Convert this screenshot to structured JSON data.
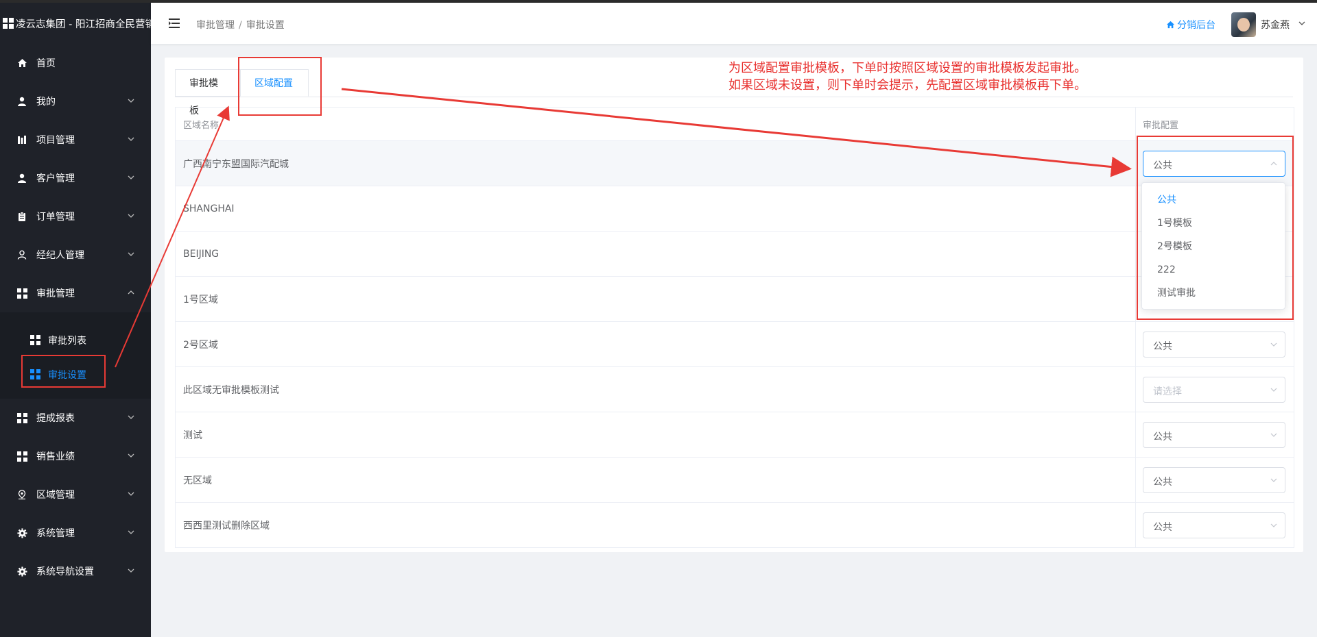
{
  "app": {
    "title": "凌云志集团 - 阳江招商全民营销"
  },
  "sidebar": {
    "items": [
      {
        "label": "首页",
        "icon": "home-icon"
      },
      {
        "label": "我的",
        "icon": "user-icon"
      },
      {
        "label": "项目管理",
        "icon": "building-icon"
      },
      {
        "label": "客户管理",
        "icon": "customer-icon"
      },
      {
        "label": "订单管理",
        "icon": "clipboard-icon"
      },
      {
        "label": "经纪人管理",
        "icon": "agent-icon"
      },
      {
        "label": "审批管理",
        "icon": "grid-icon"
      }
    ],
    "sub_items": [
      {
        "label": "审批列表",
        "icon": "grid-icon"
      },
      {
        "label": "审批设置",
        "icon": "grid-icon"
      }
    ],
    "items_after": [
      {
        "label": "提成报表",
        "icon": "grid-icon"
      },
      {
        "label": "销售业绩",
        "icon": "grid-icon"
      },
      {
        "label": "区域管理",
        "icon": "location-icon"
      },
      {
        "label": "系统管理",
        "icon": "gear-icon"
      },
      {
        "label": "系统导航设置",
        "icon": "gear-icon"
      }
    ]
  },
  "header": {
    "breadcrumb": [
      "审批管理",
      "审批设置"
    ],
    "distribution_link": "分销后台",
    "username": "苏金燕"
  },
  "tabs": [
    {
      "label": "审批模板",
      "active": false
    },
    {
      "label": "区域配置",
      "active": true
    }
  ],
  "table": {
    "columns": [
      "区域名称",
      "审批配置"
    ],
    "rows": [
      {
        "name": "广西南宁东盟国际汽配城",
        "config": "公共"
      },
      {
        "name": "SHANGHAI",
        "config": ""
      },
      {
        "name": "BEIJING",
        "config": ""
      },
      {
        "name": "1号区域",
        "config": ""
      },
      {
        "name": "2号区域",
        "config": "公共"
      },
      {
        "name": "此区域无审批模板测试",
        "config": ""
      },
      {
        "name": "测试",
        "config": "公共"
      },
      {
        "name": "无区域",
        "config": "公共"
      },
      {
        "name": "西西里测试删除区域",
        "config": "公共"
      }
    ],
    "select_placeholder": "请选择"
  },
  "dropdown": {
    "options": [
      "公共",
      "1号模板",
      "2号模板",
      "222",
      "测试审批"
    ],
    "selected": "公共"
  },
  "annotation": {
    "line1": "为区域配置审批模板，下单时按照区域设置的审批模板发起审批。",
    "line2": "如果区域未设置，则下单时会提示，先配置区域审批模板再下单。",
    "color": "#e8302e"
  },
  "colors": {
    "accent": "#1890ff",
    "sidebar_bg": "#1f2229",
    "annotation_red": "#e83a35"
  }
}
